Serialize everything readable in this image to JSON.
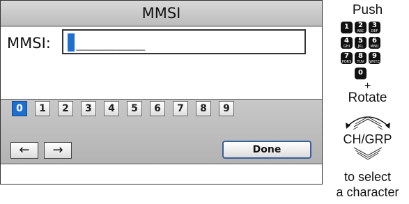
{
  "screen": {
    "title": "MMSI",
    "field_label": "MMSI:",
    "field_value": " ________"
  },
  "keypad": {
    "digits": [
      "0",
      "1",
      "2",
      "3",
      "4",
      "5",
      "6",
      "7",
      "8",
      "9"
    ],
    "selected_digit": "0",
    "left_arrow": "←",
    "right_arrow": "→",
    "done_label": "Done"
  },
  "instructions": {
    "push": "Push",
    "keys": [
      {
        "num": "1",
        "letters": ""
      },
      {
        "num": "2",
        "letters": "ABC"
      },
      {
        "num": "3",
        "letters": "DEF"
      },
      {
        "num": "4",
        "letters": "GHI"
      },
      {
        "num": "5",
        "letters": "JKL"
      },
      {
        "num": "6",
        "letters": "MNO"
      },
      {
        "num": "7",
        "letters": "PQRS"
      },
      {
        "num": "8",
        "letters": "TUV"
      },
      {
        "num": "9",
        "letters": "WXYZ"
      },
      {
        "num": "0",
        "letters": ""
      }
    ],
    "plus": "+",
    "rotate": "Rotate",
    "dial_label": "CH/GRP",
    "to_select": "to select",
    "a_character": "a character"
  },
  "colors": {
    "accent": "#1e6fd0",
    "title_bar": "#c8c8c8",
    "keypad_bg": "#bdbdbd"
  }
}
